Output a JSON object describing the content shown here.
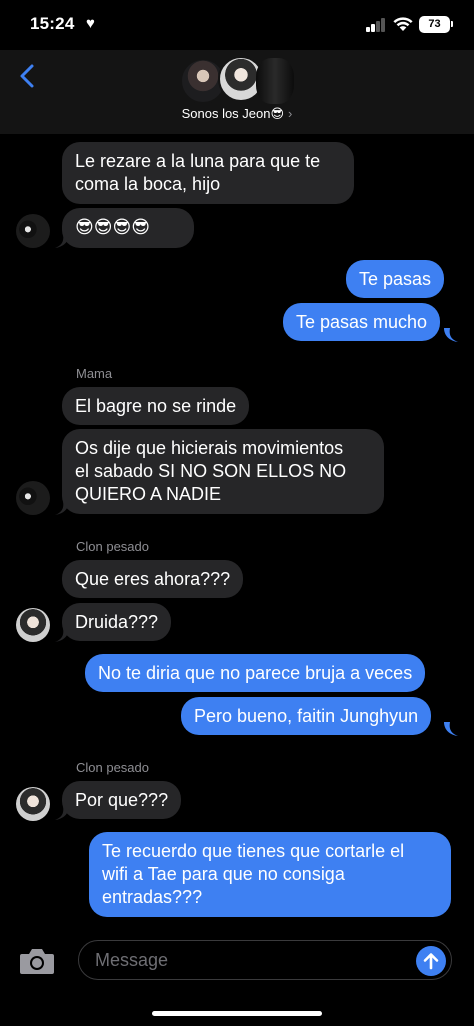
{
  "status_bar": {
    "time": "15:24",
    "battery": "73",
    "icons": [
      "heart-icon",
      "cellular-signal-icon",
      "wifi-icon",
      "battery-icon"
    ]
  },
  "header": {
    "back_icon": "chevron-left-icon",
    "group_name": "Sonos los Jeon😎",
    "chevron": "›"
  },
  "messages": {
    "m1": "Le rezare a la luna para que te",
    "m1b": "coma la boca, hijo",
    "m2": "😎😎😎😎",
    "m3": "Te pasas",
    "m4": "Te pasas mucho",
    "sender_mama": "Mama",
    "m5": "El bagre no se rinde",
    "m6a": "Os dije que hicierais movimientos",
    "m6b": "el sabado SI NO SON ELLOS NO",
    "m6c": "QUIERO A NADIE",
    "sender_clon1": "Clon pesado",
    "m7": "Que eres ahora???",
    "m8": "Druida???",
    "m9": "No te diria que no parece bruja a veces",
    "m10": "Pero bueno, faitin Junghyun",
    "sender_clon2": "Clon pesado",
    "m11": "Por que???",
    "m12a": "Te recuerdo que tienes que cortarle el",
    "m12b": "wifi a Tae para que no consiga",
    "m12c": "entradas???"
  },
  "composer": {
    "placeholder": "Message",
    "camera_icon": "camera-icon",
    "send_icon": "arrow-up-icon"
  },
  "colors": {
    "incoming_bubble": "#262628",
    "outgoing_bubble": "#3e80f2",
    "accent": "#3e80f2",
    "header_bg": "#141414"
  }
}
